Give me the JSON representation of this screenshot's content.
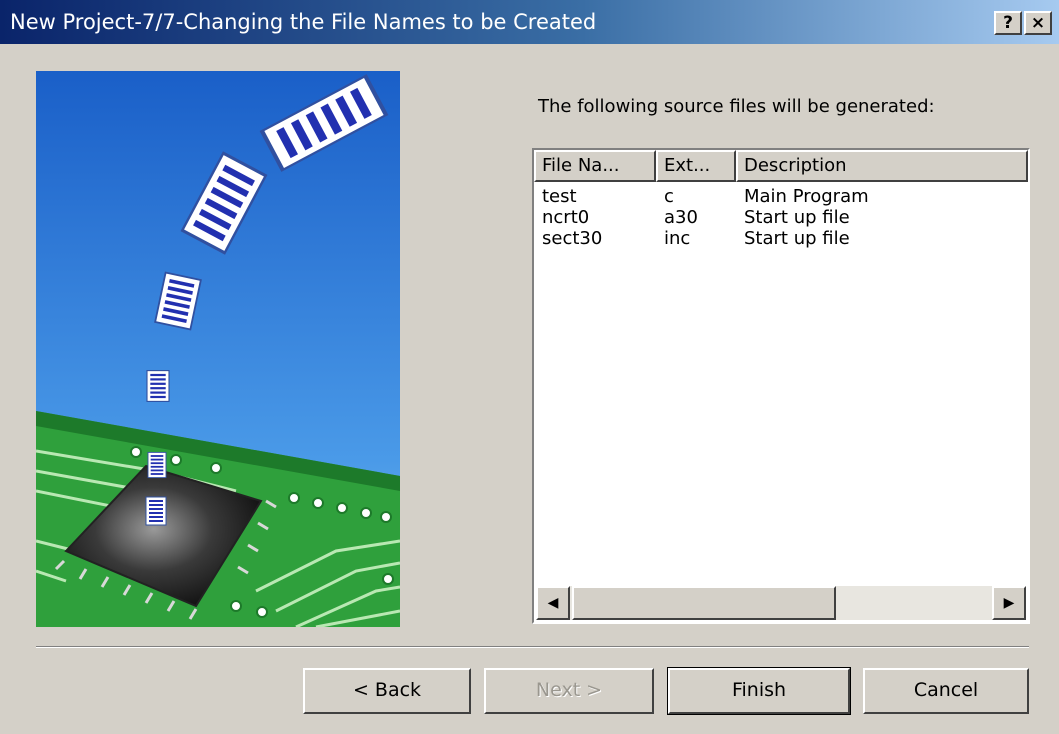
{
  "window": {
    "title": "New Project-7/7-Changing the File Names to be Created",
    "help_label": "?",
    "close_label": "×"
  },
  "prompt": "The following source files will be generated:",
  "file_list": {
    "columns": [
      "File Na...",
      "Ext...",
      "Description"
    ],
    "rows": [
      {
        "name": "test",
        "ext": "c",
        "description": "Main Program"
      },
      {
        "name": "ncrt0",
        "ext": "a30",
        "description": "Start up file"
      },
      {
        "name": "sect30",
        "ext": "inc",
        "description": "Start up file"
      }
    ]
  },
  "scrollbar": {
    "left_icon": "scroll-left-arrow",
    "right_icon": "scroll-right-arrow"
  },
  "buttons": {
    "back": "< Back",
    "next": "Next >",
    "finish": "Finish",
    "cancel": "Cancel"
  },
  "colors": {
    "titlebar_start": "#0a246a",
    "titlebar_end": "#a6caf0",
    "dialog_bg": "#d4d0c8",
    "pcb_green": "#2fa03c",
    "sky_blue": "#1f6fd0"
  }
}
